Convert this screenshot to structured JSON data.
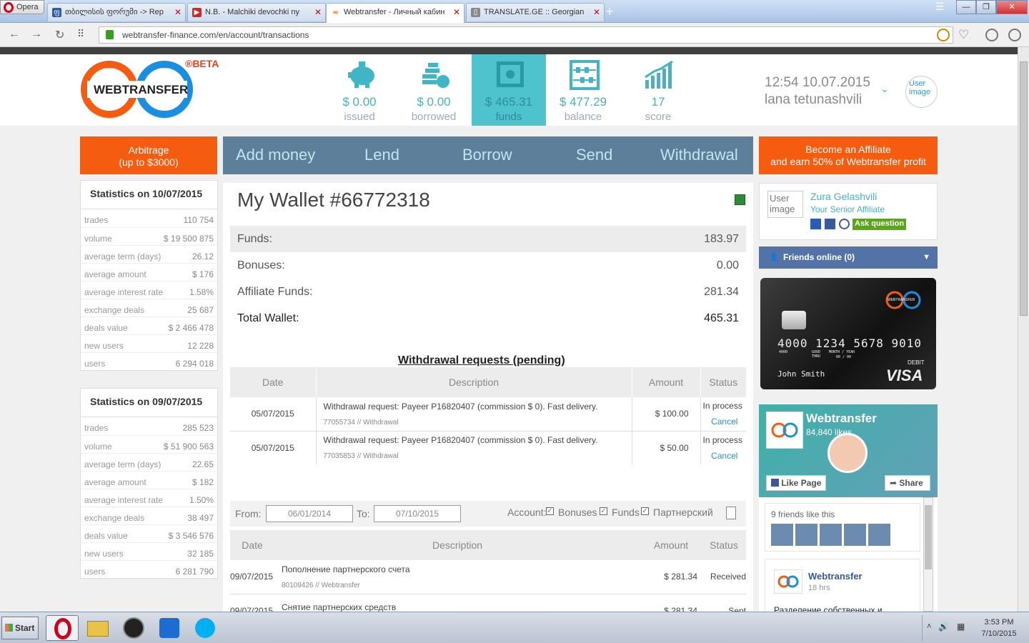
{
  "browser": {
    "opera_label": "Opera",
    "tabs": [
      {
        "label": "თბილისის ფორუმი -> Rep",
        "active": false
      },
      {
        "label": "N.B. - Malchiki devochki ny",
        "active": false
      },
      {
        "label": "Webtransfer - Личный кабин",
        "active": true
      },
      {
        "label": "TRANSLATE.GE :: Georgian",
        "active": false
      }
    ],
    "url": "webtransfer-finance.com/en/account/transactions"
  },
  "header": {
    "brand": "WEBTRANSFER",
    "beta": "®BETA",
    "stats": [
      {
        "value": "$ 0.00",
        "label": "issued",
        "icon": "piggy-bank-icon"
      },
      {
        "value": "$ 0.00",
        "label": "borrowed",
        "icon": "coins-icon"
      },
      {
        "value": "$ 465.31",
        "label": "funds",
        "icon": "safe-icon"
      },
      {
        "value": "$ 477.29",
        "label": "balance",
        "icon": "abacus-icon"
      },
      {
        "value": "17",
        "label": "score",
        "icon": "bar-chart-icon"
      }
    ],
    "time": "12:54 10.07.2015",
    "username": "lana tetunashvili",
    "avatar_alt": "User image"
  },
  "nav": {
    "arbitrage": [
      "Arbitrage",
      "(up to $3000)"
    ],
    "items": [
      "Add money",
      "Lend",
      "Borrow",
      "Send",
      "Withdrawal"
    ],
    "affiliate": [
      "Become an Affiliate",
      "and earn 50% of Webtransfer profit"
    ]
  },
  "stats_today": {
    "title": "Statistics on 10/07/2015",
    "rows": [
      [
        "trades",
        "110 754"
      ],
      [
        "volume",
        "$ 19 500 875"
      ],
      [
        "average term (days)",
        "26.12"
      ],
      [
        "average amount",
        "$ 176"
      ],
      [
        "average interest rate",
        "1.58%"
      ],
      [
        "exchange deals",
        "25 687"
      ],
      [
        "deals value",
        "$ 2 466 478"
      ],
      [
        "new users",
        "12 228"
      ],
      [
        "users",
        "6 294 018"
      ]
    ]
  },
  "stats_prev": {
    "title": "Statistics on 09/07/2015",
    "rows": [
      [
        "trades",
        "285 523"
      ],
      [
        "volume",
        "$ 51 900 563"
      ],
      [
        "average term (days)",
        "22.65"
      ],
      [
        "average amount",
        "$ 182"
      ],
      [
        "average interest rate",
        "1.50%"
      ],
      [
        "exchange deals",
        "38 497"
      ],
      [
        "deals value",
        "$ 3 546 576"
      ],
      [
        "new users",
        "32 185"
      ],
      [
        "users",
        "6 281 790"
      ]
    ]
  },
  "wallet": {
    "title": "My Wallet #66772318",
    "rows": [
      [
        "Funds:",
        "183.97"
      ],
      [
        "Bonuses:",
        "0.00"
      ],
      [
        "Affiliate Funds:",
        "281.34"
      ],
      [
        "Total Wallet:",
        "465.31"
      ]
    ],
    "withdrawals_title": "Withdrawal requests (pending)",
    "withdrawal_headers": [
      "Date",
      "Description",
      "Amount",
      "Status"
    ],
    "withdrawals": [
      {
        "date": "05/07/2015",
        "desc": "Withdrawal request: Payeer P16820407 (commission $ 0). Fast delivery.",
        "sub": "77055734 // Withdrawal",
        "amount": "$ 100.00",
        "status": "In process",
        "action": "Cancel"
      },
      {
        "date": "05/07/2015",
        "desc": "Withdrawal request: Payeer P16820407 (commission $ 0). Fast delivery.",
        "sub": "77035853 // Withdrawal",
        "amount": "$ 50.00",
        "status": "In process",
        "action": "Cancel"
      }
    ],
    "filter": {
      "from_label": "From:",
      "from": "06/01/2014",
      "to_label": "To:",
      "to": "07/10/2015",
      "account_label": "Account:",
      "options": [
        "Bonuses",
        "Funds",
        "Партнерский"
      ]
    },
    "tx_headers": [
      "Date",
      "Description",
      "Amount",
      "Status"
    ],
    "transactions": [
      {
        "date": "09/07/2015",
        "desc": "Пополнение партнерского счета",
        "sub": "80109426 // Webtransfer",
        "amount": "$ 281.34",
        "status": "Received"
      },
      {
        "date": "09/07/2015",
        "desc": "Снятие партнерских средств",
        "sub": "",
        "amount": "$ 281.34",
        "status": "Sent"
      }
    ]
  },
  "sidebar": {
    "affiliate_name": "Zura Gelashvili",
    "affiliate_role": "Your Senior Affiliate",
    "ask": "Ask question",
    "avatar_alt": "User image",
    "friends": "Friends online (0)",
    "card": {
      "number": "4000 1234 5678 9010",
      "small": "4000",
      "valid": "GOOD THRU",
      "month": "MONTH / YEAR",
      "exp": "00 / 00",
      "holder": "John Smith",
      "debit": "DEBIT",
      "brand": "VISA",
      "logo": "WEBTRANSFER"
    },
    "fb": {
      "page": "Webtransfer",
      "likes": "84,840 likes",
      "like_btn": "Like Page",
      "share_btn": "Share",
      "friends_like": "9 friends like this",
      "post_author": "Webtransfer",
      "post_time": "18 hrs",
      "post_text": "Разделение собственных и"
    }
  },
  "taskbar": {
    "start": "Start",
    "time": "3:53 PM",
    "date": "7/10/2015"
  }
}
